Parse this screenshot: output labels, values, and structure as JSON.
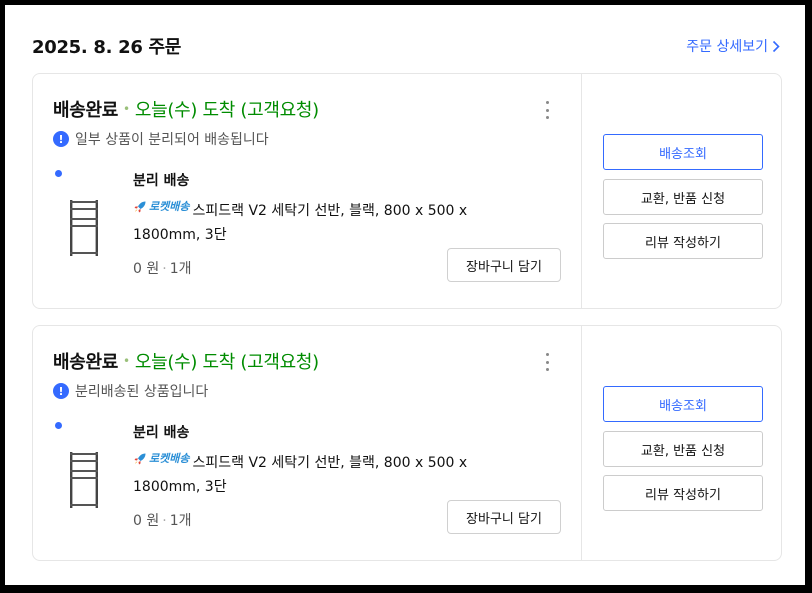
{
  "header": {
    "order_date": "2025. 8. 26 주문",
    "detail_link": "주문 상세보기"
  },
  "colors": {
    "accent": "#346aff",
    "arrival_green": "#008c00",
    "rocket_blue": "#2b8fd6"
  },
  "orders": [
    {
      "status": "배송완료",
      "arrival": "오늘(수) 도착 (고객요청)",
      "notice": "일부 상품이 분리되어 배송됩니다",
      "shipment_label": "분리 배송",
      "rocket_badge": "로켓배송",
      "product_name": "스피드랙 V2 세탁기 선반, 블랙, 800 x 500 x 1800mm, 3단",
      "price": "0 원",
      "quantity": "1개",
      "cart_button": "장바구니 담기",
      "actions": {
        "track": "배송조회",
        "exchange": "교환, 반품 신청",
        "review": "리뷰 작성하기"
      },
      "icons": [
        "exclamation-circle-icon",
        "more-vertical-icon",
        "rocket-icon"
      ]
    },
    {
      "status": "배송완료",
      "arrival": "오늘(수) 도착 (고객요청)",
      "notice": "분리배송된 상품입니다",
      "shipment_label": "분리 배송",
      "rocket_badge": "로켓배송",
      "product_name": "스피드랙 V2 세탁기 선반, 블랙, 800 x 500 x 1800mm, 3단",
      "price": "0 원",
      "quantity": "1개",
      "cart_button": "장바구니 담기",
      "actions": {
        "track": "배송조회",
        "exchange": "교환, 반품 신청",
        "review": "리뷰 작성하기"
      },
      "icons": [
        "exclamation-circle-icon",
        "more-vertical-icon",
        "rocket-icon"
      ]
    }
  ]
}
